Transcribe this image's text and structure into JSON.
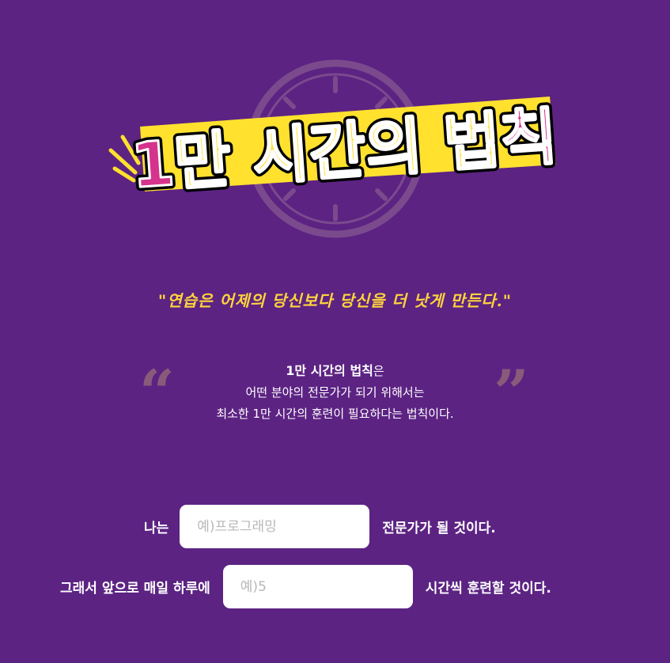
{
  "header": {
    "title": "1만 시간의 법칙",
    "title_part1": "1",
    "title_part2": "만 시간의 법",
    "title_part3": "칙"
  },
  "quote": "\"연습은 어제의 당신보다 당신을 더 낫게 만든다.\"",
  "description": {
    "open_mark": "“",
    "close_mark": "”",
    "highlight": "1만 시간의 법칙",
    "line1_suffix": "은",
    "line2": "어떤 분야의 전문가가 되기 위해서는",
    "line3": "최소한 1만 시간의 훈련이 필요하다는 법칙이다."
  },
  "form": {
    "row1": {
      "prefix": "나는",
      "placeholder": "예)프로그래밍",
      "value": "",
      "suffix": "전문가가 될 것이다."
    },
    "row2": {
      "prefix": "그래서 앞으로 매일 하루에",
      "placeholder": "예)5",
      "value": "",
      "suffix": "시간씩 훈련할 것이다."
    }
  },
  "colors": {
    "background": "#5c2383",
    "accent_yellow": "#ffe12e",
    "accent_pink": "#d6338c",
    "quote_color": "#ffd43b",
    "quote_mark_color": "#8a5a7a"
  },
  "icons": {
    "clock": "clock-icon",
    "burst": "burst-lines-icon"
  }
}
